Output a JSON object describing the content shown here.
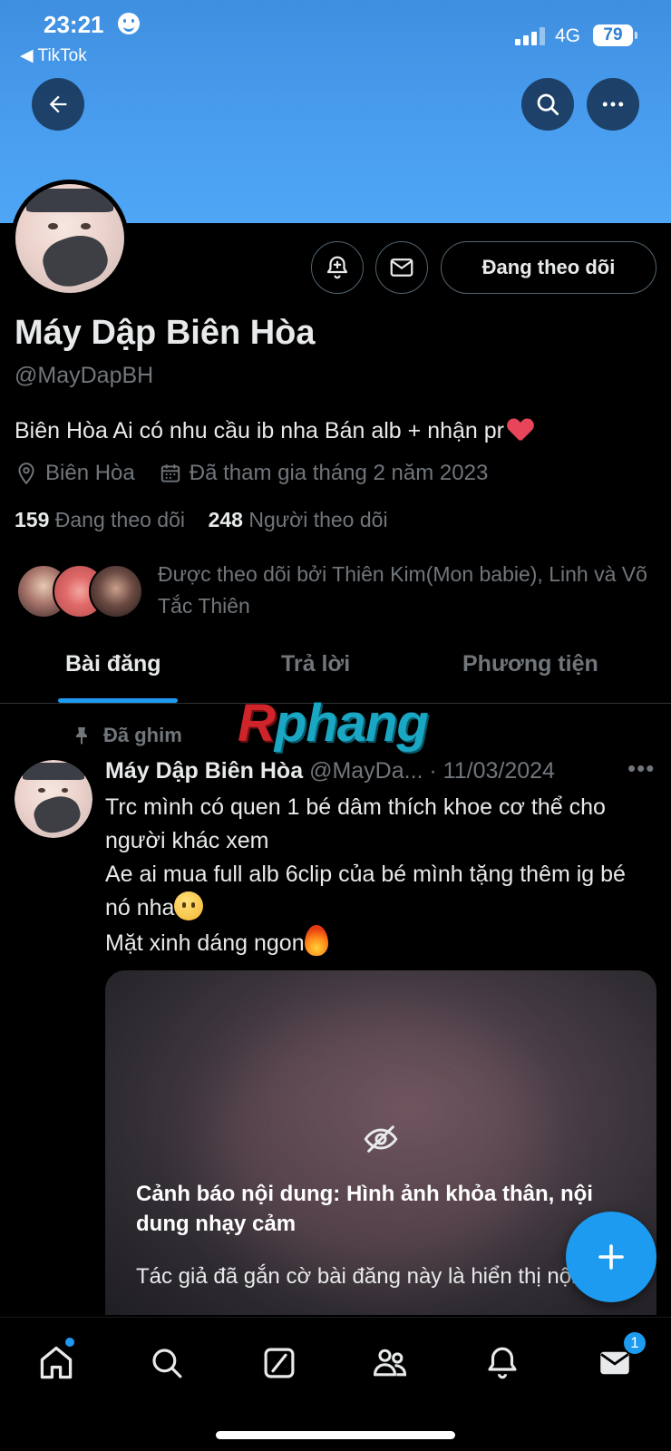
{
  "status_bar": {
    "time": "23:21",
    "back_app": "◀ TikTok",
    "network": "4G",
    "battery": "79"
  },
  "profile": {
    "name": "Máy Dập Biên Hòa",
    "handle": "@MayDapBH",
    "bio": "Biên Hòa Ai có nhu cầu ib nha Bán alb + nhận pr",
    "location": "Biên Hòa",
    "joined": "Đã tham gia tháng 2 năm 2023",
    "following_count": "159",
    "following_label": "Đang theo dõi",
    "followers_count": "248",
    "followers_label": "Người theo dõi",
    "followed_by": "Được theo dõi bởi Thiên Kim(Mon babie), Linh và Võ Tắc Thiên",
    "follow_button": "Đang theo dõi"
  },
  "tabs": [
    {
      "label": "Bài đăng",
      "active": true
    },
    {
      "label": "Trả lời",
      "active": false
    },
    {
      "label": "Phương tiện",
      "active": false
    }
  ],
  "watermark": {
    "r": "R",
    "rest": "phang"
  },
  "post": {
    "pinned_label": "Đã ghim",
    "author": "Máy Dập Biên Hòa",
    "handle_date": "@MayDa... · 11/03/2024",
    "line1": "Trc mình có quen 1 bé dâm thích khoe cơ thể cho người khác xem",
    "line2": "Ae ai mua full alb 6clip của bé mình tặng thêm ig bé nó nha",
    "line3": "Mặt xinh dáng ngon",
    "warning_title": "Cảnh báo nội dung: Hình ảnh khỏa thân, nội dung nhạy cảm",
    "warning_body": "Tác giả đã gắn cờ bài đăng này là hiển thị nội dung nhạy cảm."
  },
  "nav": {
    "messages_badge": "1"
  },
  "colors": {
    "accent": "#1d9bf0",
    "banner": "#4a9ef0",
    "secondary_text": "#71767b"
  }
}
